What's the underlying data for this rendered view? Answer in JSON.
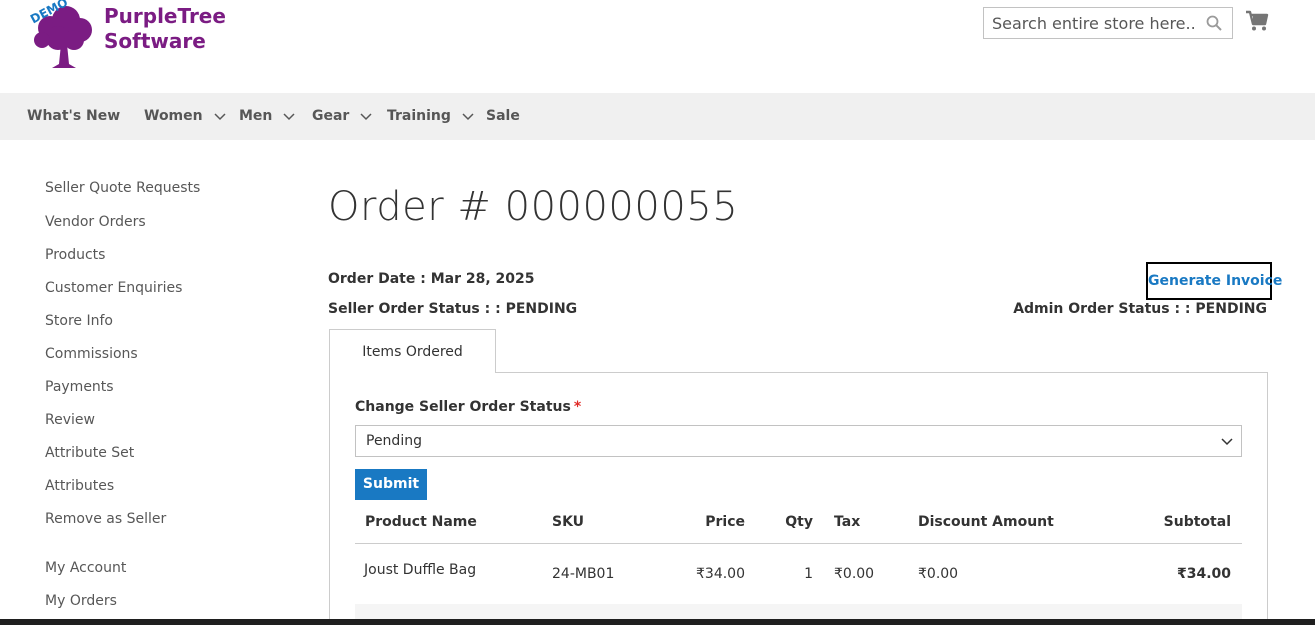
{
  "header": {
    "logo": {
      "demo_badge": "DEMO",
      "line1": "PurpleTree",
      "line2": "Software"
    },
    "search": {
      "placeholder": "Search entire store here..."
    },
    "icons": {
      "search": "search-icon",
      "cart": "cart-icon"
    }
  },
  "nav": {
    "items": [
      {
        "label": "What's New",
        "has_dropdown": false
      },
      {
        "label": "Women",
        "has_dropdown": true
      },
      {
        "label": "Men",
        "has_dropdown": true
      },
      {
        "label": "Gear",
        "has_dropdown": true
      },
      {
        "label": "Training",
        "has_dropdown": true
      },
      {
        "label": "Sale",
        "has_dropdown": false
      }
    ]
  },
  "sidebar": {
    "items": [
      {
        "label": "Seller Quote Requests"
      },
      {
        "label": "Vendor Orders"
      },
      {
        "label": "Products"
      },
      {
        "label": "Customer Enquiries"
      },
      {
        "label": "Store Info"
      },
      {
        "label": "Commissions"
      },
      {
        "label": "Payments"
      },
      {
        "label": "Review"
      },
      {
        "label": "Attribute Set"
      },
      {
        "label": "Attributes"
      },
      {
        "label": "Remove as Seller"
      },
      {
        "label": "My Account"
      },
      {
        "label": "My Orders"
      }
    ]
  },
  "main": {
    "title": "Order # 000000055",
    "order_date": "Order Date : Mar 28, 2025",
    "seller_status": "Seller Order Status : : PENDING",
    "admin_status": "Admin Order Status : : PENDING",
    "generate_invoice": "Generate Invoice",
    "tab": "Items Ordered",
    "form": {
      "label": "Change Seller Order Status",
      "required_mark": "*",
      "selected": "Pending",
      "submit": "Submit"
    },
    "table": {
      "headers": [
        "Product Name",
        "SKU",
        "Price",
        "Qty",
        "Tax",
        "Discount Amount",
        "Subtotal"
      ],
      "rows": [
        [
          "Joust Duffle Bag",
          "24-MB01",
          "₹34.00",
          "1",
          "₹0.00",
          "₹0.00",
          "₹34.00"
        ]
      ]
    }
  },
  "colors": {
    "brand_purple": "#7b1c83",
    "link_blue": "#1979c3",
    "nav_bg": "#f0f0f0"
  }
}
